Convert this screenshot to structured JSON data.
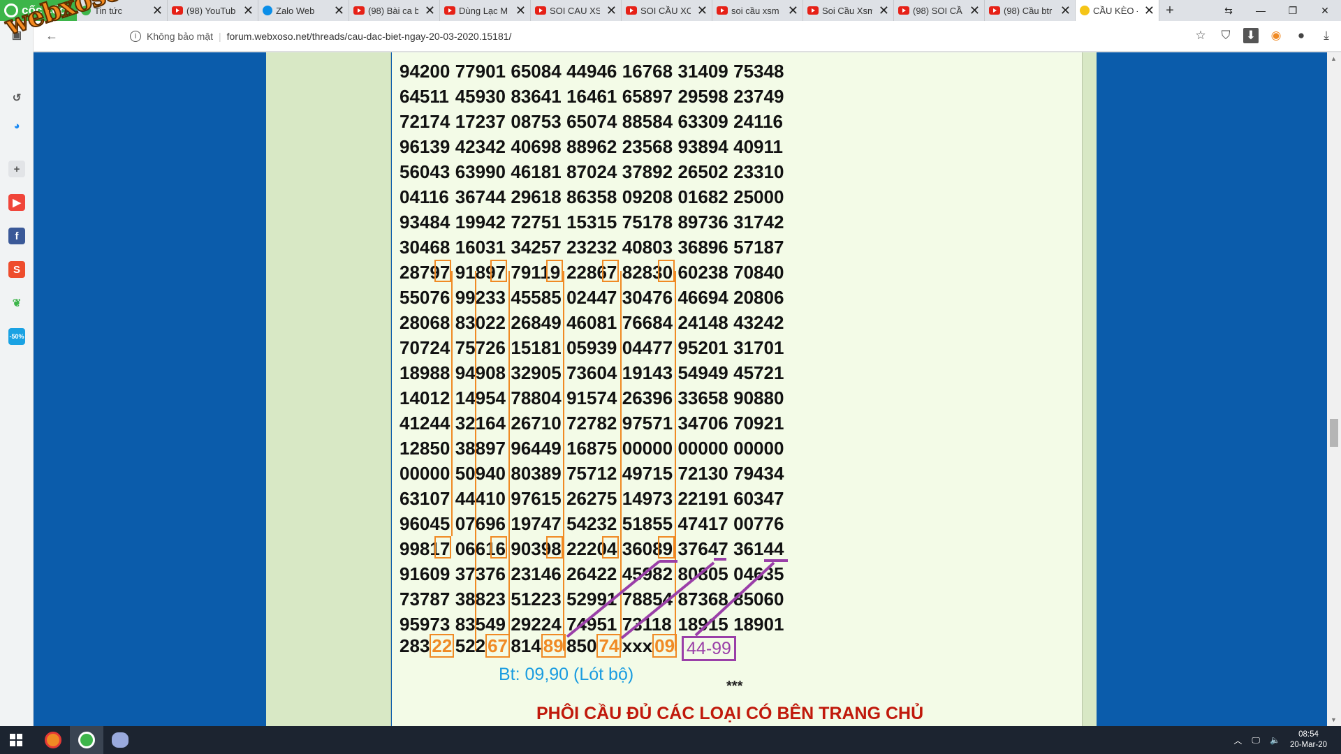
{
  "browser": {
    "brand": "cốc cốc",
    "tabs": [
      {
        "title": "Tin tức",
        "icon": "news-icon"
      },
      {
        "title": "(98) YouTub",
        "icon": "youtube-icon"
      },
      {
        "title": "Zalo Web",
        "icon": "zalo-icon"
      },
      {
        "title": "(98) Bài ca b",
        "icon": "youtube-icon"
      },
      {
        "title": "Dùng Lạc M",
        "icon": "youtube-icon"
      },
      {
        "title": "SOI CAU XS",
        "icon": "youtube-icon"
      },
      {
        "title": "SOI CẦU XC",
        "icon": "youtube-icon"
      },
      {
        "title": "soi cầu xsm",
        "icon": "youtube-icon"
      },
      {
        "title": "Soi Cầu Xsm",
        "icon": "youtube-icon"
      },
      {
        "title": "(98) SOI CẦ",
        "icon": "youtube-icon"
      },
      {
        "title": "(98) Cầu btr",
        "icon": "youtube-icon"
      },
      {
        "title": "CẦU KÈO -",
        "icon": "webxoso-icon"
      }
    ],
    "security_label": "Không bảo mật",
    "url": "forum.webxoso.net/threads/cau-dac-biet-ngay-20-03-2020.15181/",
    "watermark": "webxoso.net"
  },
  "grid": [
    [
      "94200",
      "77901",
      "65084",
      "44946",
      "16768",
      "31409",
      "75348"
    ],
    [
      "64511",
      "45930",
      "83641",
      "16461",
      "65897",
      "29598",
      "23749"
    ],
    [
      "72174",
      "17237",
      "08753",
      "65074",
      "88584",
      "63309",
      "24116"
    ],
    [
      "96139",
      "42342",
      "40698",
      "88962",
      "23568",
      "93894",
      "40911"
    ],
    [
      "56043",
      "63990",
      "46181",
      "87024",
      "37892",
      "26502",
      "23310"
    ],
    [
      "04116",
      "36744",
      "29618",
      "86358",
      "09208",
      "01682",
      "25000"
    ],
    [
      "93484",
      "19942",
      "72751",
      "15315",
      "75178",
      "89736",
      "31742"
    ],
    [
      "30468",
      "16031",
      "34257",
      "23232",
      "40803",
      "36896",
      "57187"
    ],
    [
      "28797",
      "91897",
      "79119",
      "22867",
      "82830",
      "60238",
      "70840"
    ],
    [
      "55076",
      "99233",
      "45585",
      "02447",
      "30476",
      "46694",
      "20806"
    ],
    [
      "28068",
      "83022",
      "26849",
      "46081",
      "76684",
      "24148",
      "43242"
    ],
    [
      "70724",
      "75726",
      "15181",
      "05939",
      "04477",
      "95201",
      "31701"
    ],
    [
      "18988",
      "94908",
      "32905",
      "73604",
      "19143",
      "54949",
      "45721"
    ],
    [
      "14012",
      "14954",
      "78804",
      "91574",
      "26396",
      "33658",
      "90880"
    ],
    [
      "41244",
      "32164",
      "26710",
      "72782",
      "97571",
      "34706",
      "70921"
    ],
    [
      "12850",
      "38897",
      "96449",
      "16875",
      "00000",
      "00000",
      "00000"
    ],
    [
      "00000",
      "50940",
      "80389",
      "75712",
      "49715",
      "72130",
      "79434"
    ],
    [
      "63107",
      "44410",
      "97615",
      "26275",
      "14973",
      "22191",
      "60347"
    ],
    [
      "96045",
      "07696",
      "19747",
      "54232",
      "51855",
      "47417",
      "00776"
    ],
    [
      "99817",
      "06616",
      "90398",
      "22204",
      "36089",
      "37647",
      "36144"
    ],
    [
      "91609",
      "37376",
      "23146",
      "26422",
      "45982",
      "80805",
      "04635"
    ],
    [
      "73787",
      "38823",
      "51223",
      "52991",
      "78854",
      "87368",
      "85060"
    ],
    [
      "95973",
      "83549",
      "29224",
      "74951",
      "73118",
      "18915",
      "18901"
    ]
  ],
  "last_row": {
    "items": [
      {
        "prefix": "283",
        "boxed": "22"
      },
      {
        "prefix": "522",
        "boxed": "67"
      },
      {
        "prefix": "814",
        "boxed": "89"
      },
      {
        "prefix": "850",
        "boxed": "74"
      }
    ],
    "xxx": "xxx",
    "result": "09",
    "prediction": "44-99"
  },
  "bt_line": "Bt: 09,90 (Lót bộ)",
  "stars": "***",
  "footer_heading": "PHÔI CẦU ĐỦ CÁC LOẠI CÓ BÊN TRANG CHỦ",
  "taskbar": {
    "time": "08:54",
    "date": "20-Mar-20"
  },
  "colors": {
    "page_bg": "#0b5cab",
    "highlight": "#f08a24",
    "prediction": "#9a3fa8",
    "bt": "#1a9ce0",
    "heading": "#c0190b"
  }
}
